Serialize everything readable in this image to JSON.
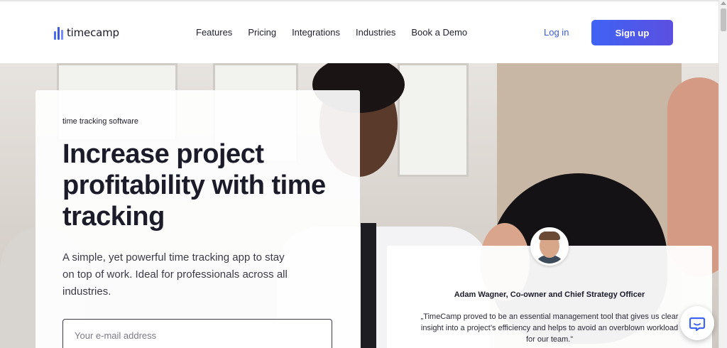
{
  "brand": {
    "name": "timecamp",
    "accent": "#3f63f5"
  },
  "nav": {
    "items": [
      "Features",
      "Pricing",
      "Integrations",
      "Industries",
      "Book a Demo"
    ],
    "login_label": "Log in",
    "signup_label": "Sign up"
  },
  "hero": {
    "eyebrow": "time tracking software",
    "headline": "Increase project profitability with time tracking",
    "subtext": "A simple, yet powerful time tracking app to stay on top of work. Ideal for professionals across all industries.",
    "email_placeholder": "Your e-mail address"
  },
  "testimonial": {
    "name": "Adam Wagner, Co-owner and Chief Strategy Officer",
    "quote": "„TimeCamp proved to be an essential management tool that gives us clear insight into a project’s efficiency and helps to avoid an overblown workload for our team.”"
  },
  "icons": {
    "chat": "chat-bubble-icon",
    "logo": "timecamp-logo-icon"
  }
}
